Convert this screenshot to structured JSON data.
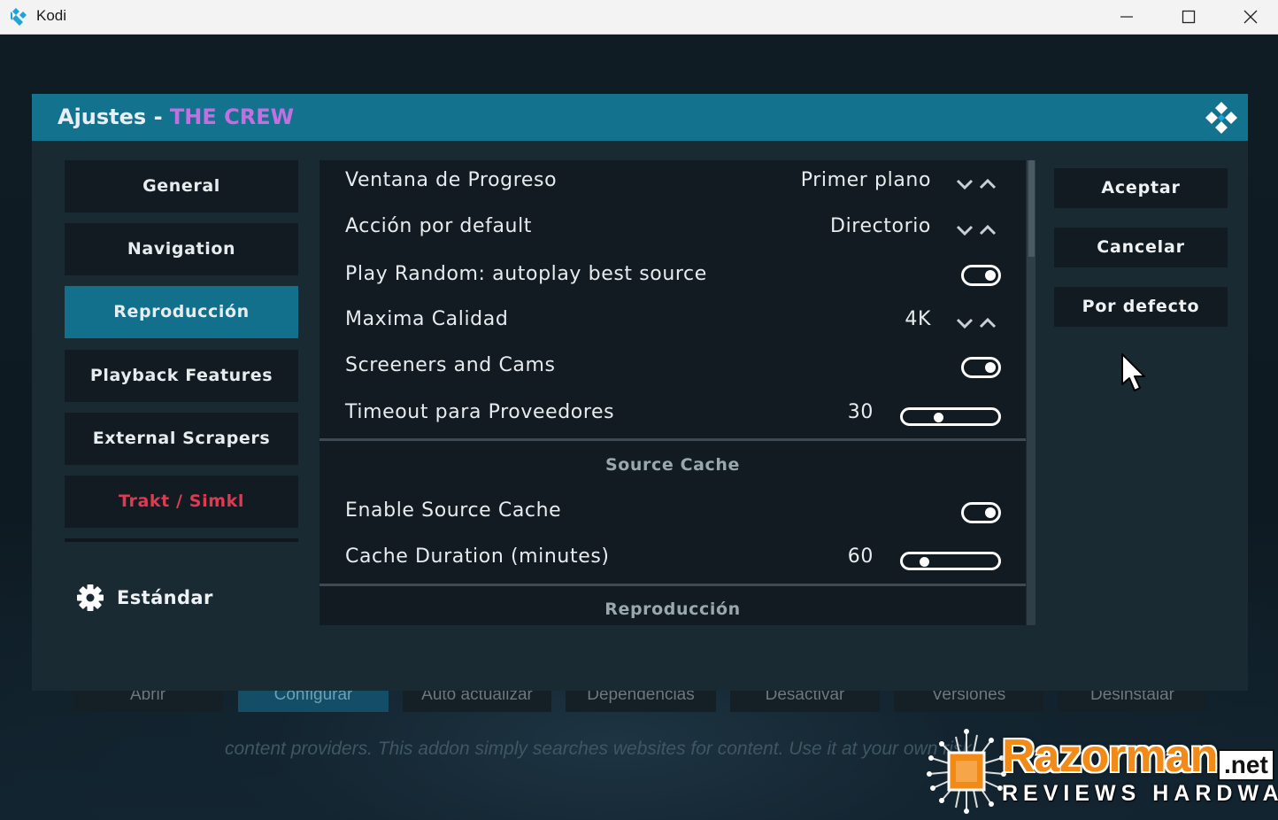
{
  "window": {
    "title": "Kodi"
  },
  "background": {
    "buttons": [
      {
        "label": "Abrir",
        "active": false
      },
      {
        "label": "Configurar",
        "active": true
      },
      {
        "label": "Auto actualizar",
        "active": false
      },
      {
        "label": "Dependencias",
        "active": false
      },
      {
        "label": "Desactivar",
        "active": false
      },
      {
        "label": "Versiones",
        "active": false
      },
      {
        "label": "Desinstalar",
        "active": false
      }
    ],
    "description": "content providers. This addon simply searches websites for content. Use it at your own risk."
  },
  "dialog": {
    "title_prefix": "Ajustes - ",
    "addon_name": "THE CREW",
    "addon_color": "#c56ee0",
    "categories": [
      {
        "label": "General",
        "selected": false
      },
      {
        "label": "Navigation",
        "selected": false
      },
      {
        "label": "Reproducción",
        "selected": true
      },
      {
        "label": "Playback Features",
        "selected": false
      },
      {
        "label": "External Scrapers",
        "selected": false
      },
      {
        "label": "Trakt / Simkl",
        "selected": false,
        "color": "#e03a52"
      }
    ],
    "settings_level": {
      "label": "Estándar",
      "icon": "gear-icon"
    },
    "settings": {
      "ventana": {
        "label": "Ventana de Progreso",
        "value": "Primer plano"
      },
      "accion": {
        "label": "Acción por default",
        "value": "Directorio"
      },
      "play_random": {
        "label": "Play Random: autoplay best source",
        "enabled": true
      },
      "calidad": {
        "label": "Maxima Calidad",
        "value": "4K"
      },
      "screeners": {
        "label": "Screeners and Cams",
        "enabled": true
      },
      "timeout": {
        "label": "Timeout para Proveedores",
        "value": "30",
        "fraction": 0.35
      },
      "group_cache": "Source Cache",
      "enable_cache": {
        "label": "Enable Source Cache",
        "enabled": true
      },
      "cache_duration": {
        "label": "Cache Duration (minutes)",
        "value": "60",
        "fraction": 0.18
      },
      "group_repro": "Reproducción"
    },
    "actions": {
      "ok": "Aceptar",
      "cancel": "Cancelar",
      "defaults": "Por defecto"
    }
  },
  "watermark": {
    "name": "Razorman",
    "tld": ".net",
    "tagline": "REVIEWS HARDWARE"
  },
  "colors": {
    "header": "#13738f",
    "selected": "#12708c",
    "panel": "#111b21"
  }
}
